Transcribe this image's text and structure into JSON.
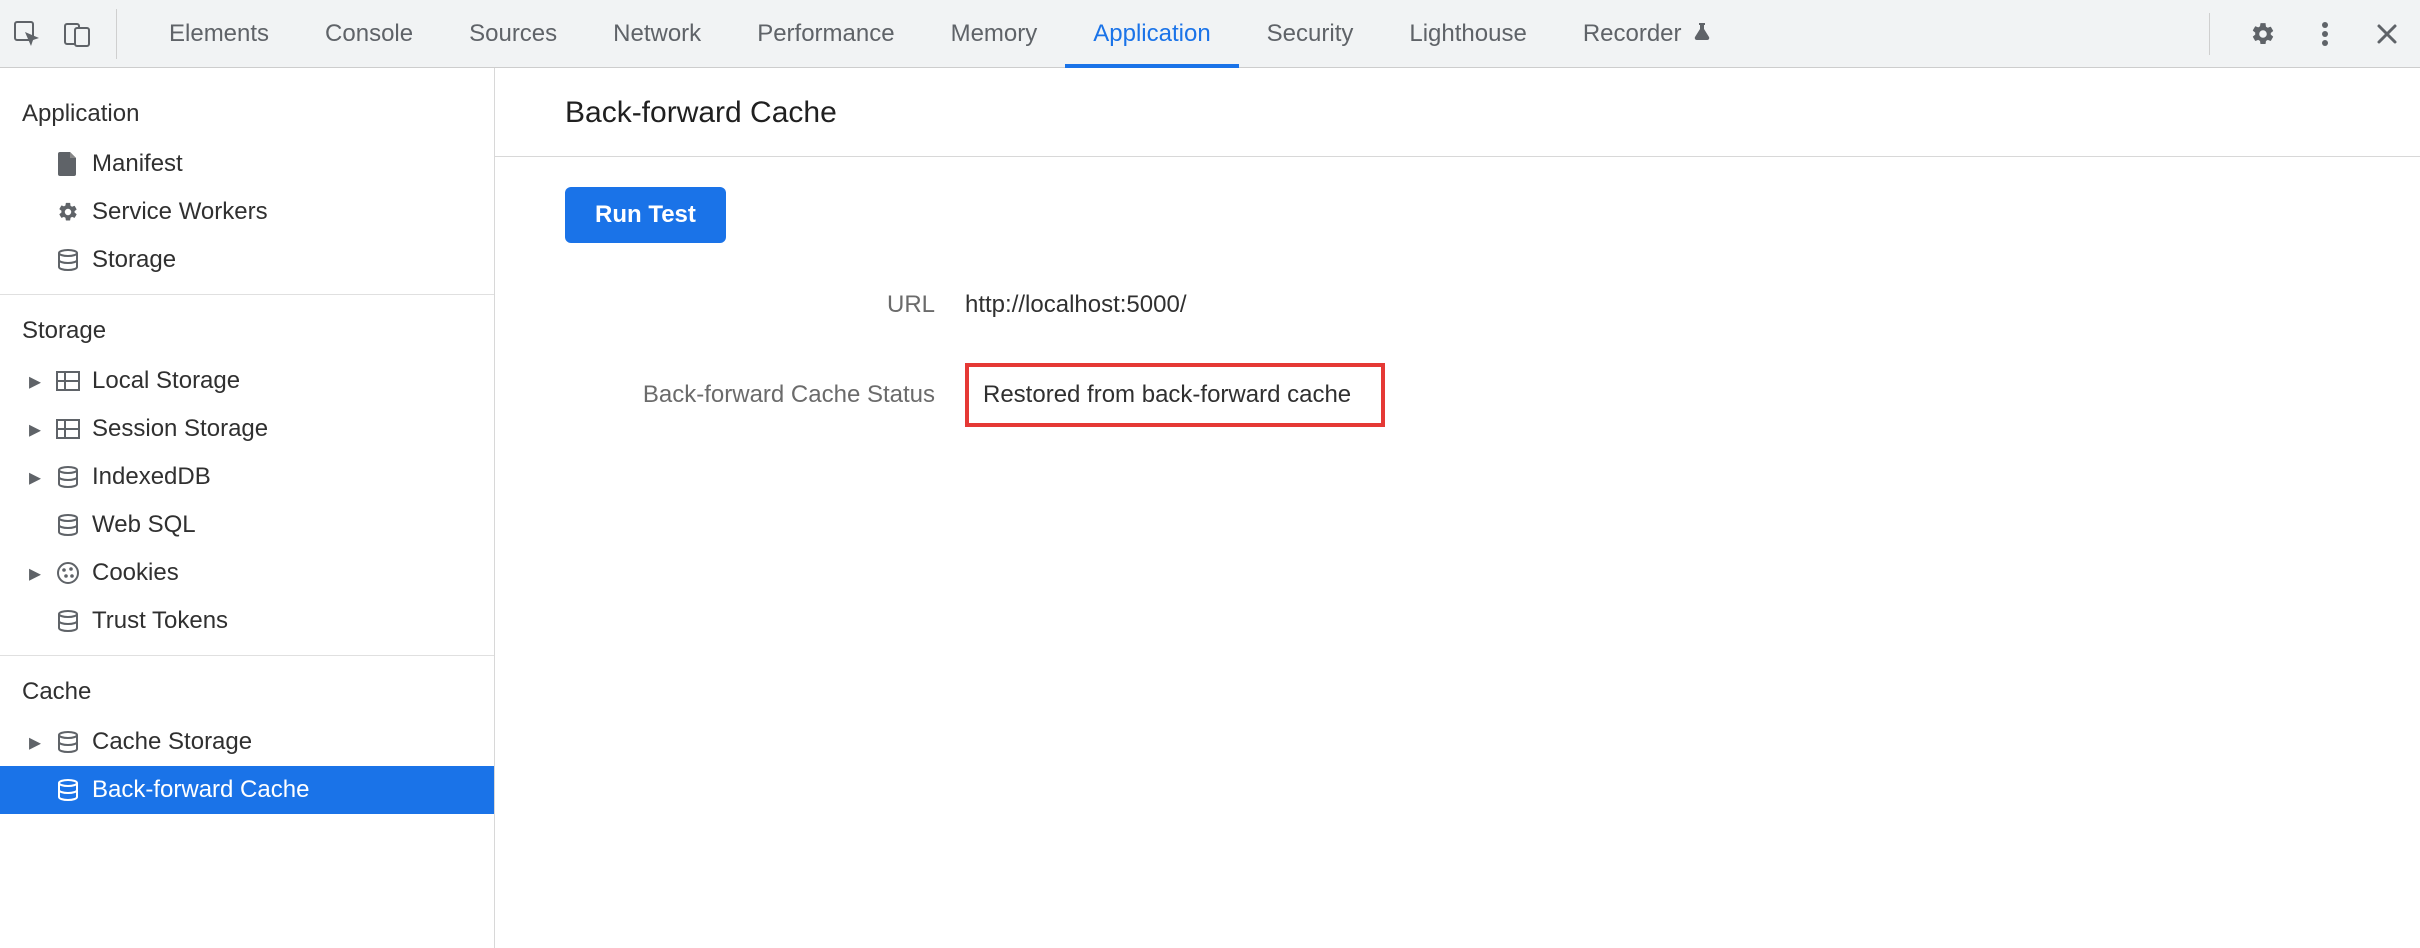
{
  "tabs": [
    {
      "label": "Elements",
      "active": false
    },
    {
      "label": "Console",
      "active": false
    },
    {
      "label": "Sources",
      "active": false
    },
    {
      "label": "Network",
      "active": false
    },
    {
      "label": "Performance",
      "active": false
    },
    {
      "label": "Memory",
      "active": false
    },
    {
      "label": "Application",
      "active": true
    },
    {
      "label": "Security",
      "active": false
    },
    {
      "label": "Lighthouse",
      "active": false
    },
    {
      "label": "Recorder",
      "active": false,
      "beaker": true
    }
  ],
  "sidebar": {
    "groups": [
      {
        "title": "Application",
        "items": [
          {
            "label": "Manifest",
            "icon": "file",
            "arrow": false
          },
          {
            "label": "Service Workers",
            "icon": "gear",
            "arrow": false
          },
          {
            "label": "Storage",
            "icon": "db",
            "arrow": false
          }
        ]
      },
      {
        "title": "Storage",
        "items": [
          {
            "label": "Local Storage",
            "icon": "grid",
            "arrow": true
          },
          {
            "label": "Session Storage",
            "icon": "grid",
            "arrow": true
          },
          {
            "label": "IndexedDB",
            "icon": "db",
            "arrow": true
          },
          {
            "label": "Web SQL",
            "icon": "db",
            "arrow": false
          },
          {
            "label": "Cookies",
            "icon": "cookie",
            "arrow": true
          },
          {
            "label": "Trust Tokens",
            "icon": "db",
            "arrow": false
          }
        ]
      },
      {
        "title": "Cache",
        "items": [
          {
            "label": "Cache Storage",
            "icon": "db",
            "arrow": true
          },
          {
            "label": "Back-forward Cache",
            "icon": "db",
            "arrow": false,
            "selected": true
          }
        ]
      }
    ]
  },
  "main": {
    "title": "Back-forward Cache",
    "run_button": "Run Test",
    "url_label": "URL",
    "url_value": "http://localhost:5000/",
    "status_label": "Back-forward Cache Status",
    "status_value": "Restored from back-forward cache"
  }
}
